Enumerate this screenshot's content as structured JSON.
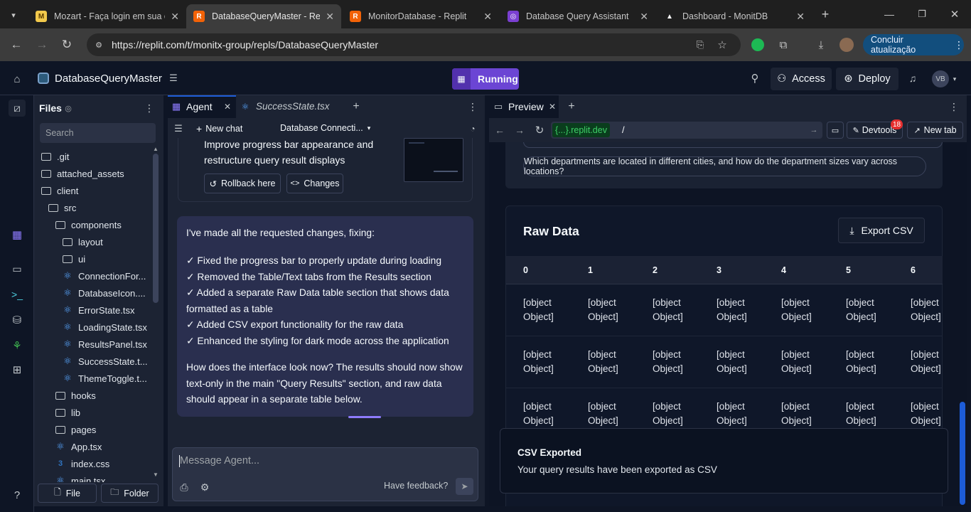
{
  "browser": {
    "tabs": [
      {
        "title": "Mozart - Faça login em sua c",
        "fav": "M",
        "favbg": "#f2c94c",
        "favfg": "#5a3b00"
      },
      {
        "title": "DatabaseQueryMaster - Repl",
        "fav": "R",
        "favbg": "#f26207",
        "favfg": "#fff"
      },
      {
        "title": "MonitorDatabase - Replit",
        "fav": "R",
        "favbg": "#f26207",
        "favfg": "#fff"
      },
      {
        "title": "Database Query Assistant",
        "fav": "◎",
        "favbg": "#7a3fd1",
        "favfg": "#fff"
      },
      {
        "title": "Dashboard - MonitDB",
        "fav": "▲",
        "favbg": "#1f1f1f",
        "favfg": "#fff"
      }
    ],
    "url": "https://replit.com/t/monitx-group/repls/DatabaseQueryMaster",
    "update_button": "Concluir atualização"
  },
  "header": {
    "repl_name": "DatabaseQueryMaster",
    "status": "Running",
    "access_label": "Access",
    "deploy_label": "Deploy",
    "avatar_initials": "VB"
  },
  "files": {
    "title": "Files",
    "search_placeholder": "Search",
    "tree": [
      {
        "name": ".git",
        "type": "folder",
        "depth": 0
      },
      {
        "name": "attached_assets",
        "type": "folder",
        "depth": 0
      },
      {
        "name": "client",
        "type": "folder",
        "depth": 0
      },
      {
        "name": "src",
        "type": "folder",
        "depth": 1
      },
      {
        "name": "components",
        "type": "folder",
        "depth": 2
      },
      {
        "name": "layout",
        "type": "folder",
        "depth": 3
      },
      {
        "name": "ui",
        "type": "folder",
        "depth": 3
      },
      {
        "name": "ConnectionFor...",
        "type": "react",
        "depth": 3
      },
      {
        "name": "DatabaseIcon....",
        "type": "react",
        "depth": 3
      },
      {
        "name": "ErrorState.tsx",
        "type": "react",
        "depth": 3
      },
      {
        "name": "LoadingState.tsx",
        "type": "react",
        "depth": 3
      },
      {
        "name": "ResultsPanel.tsx",
        "type": "react",
        "depth": 3
      },
      {
        "name": "SuccessState.t...",
        "type": "react",
        "depth": 3
      },
      {
        "name": "ThemeToggle.t...",
        "type": "react",
        "depth": 3
      },
      {
        "name": "hooks",
        "type": "folder",
        "depth": 2
      },
      {
        "name": "lib",
        "type": "folder",
        "depth": 2
      },
      {
        "name": "pages",
        "type": "folder",
        "depth": 2
      },
      {
        "name": "App.tsx",
        "type": "react",
        "depth": 2
      },
      {
        "name": "index.css",
        "type": "css",
        "depth": 2
      },
      {
        "name": "main.tsx",
        "type": "react",
        "depth": 2
      }
    ],
    "file_button": "File",
    "folder_button": "Folder"
  },
  "agent": {
    "tab_agent": "Agent",
    "tab_file": "SuccessState.tsx",
    "new_chat": "New chat",
    "chat_title": "Database Connecti...",
    "checkpoint_title": "Improve progress bar appearance and restructure query result displays",
    "rollback_label": "Rollback here",
    "changes_label": "Changes",
    "message_intro": "I've made all the requested changes, fixing:",
    "message_items": [
      "✓ Fixed the progress bar to properly update during loading",
      "✓ Removed the Table/Text tabs from the Results section",
      "✓ Added a separate Raw Data table section that shows data formatted as a table",
      "✓ Added CSV export functionality for the raw data",
      "✓ Enhanced the styling for dark mode across the application"
    ],
    "message_outro": "How does the interface look now? The results should now show text-only in the main \"Query Results\" section, and raw data should appear in a separate table below.",
    "input_placeholder": "Message Agent...",
    "feedback_label": "Have feedback?"
  },
  "preview": {
    "tab_label": "Preview",
    "url_badge": "{...}.replit.dev",
    "url_path": "/",
    "devtools_label": "Devtools",
    "devtools_badge": "18",
    "new_tab_label": "New tab",
    "suggestion": "Which departments are located in different cities, and how do the department sizes vary across locations?",
    "raw_data_title": "Raw Data",
    "export_label": "Export CSV",
    "columns": [
      "0",
      "1",
      "2",
      "3",
      "4",
      "5",
      "6"
    ],
    "rows": [
      [
        "[object Object]",
        "[object Object]",
        "[object Object]",
        "[object Object]",
        "[object Object]",
        "[object Object]",
        "[object Object]"
      ],
      [
        "[object Object]",
        "[object Object]",
        "[object Object]",
        "[object Object]",
        "[object Object]",
        "[object Object]",
        "[object Object]"
      ],
      [
        "[object Object]",
        "[object Object]",
        "[object Object]",
        "[object Object]",
        "[object Object]",
        "[object Object]",
        "[object Object]"
      ]
    ],
    "toast_title": "CSV Exported",
    "toast_body": "Your query results have been exported as CSV"
  },
  "colors": {
    "accent_purple": "#6b45d4",
    "link_green": "#0a8a2f",
    "badge_red": "#e52e2e"
  }
}
